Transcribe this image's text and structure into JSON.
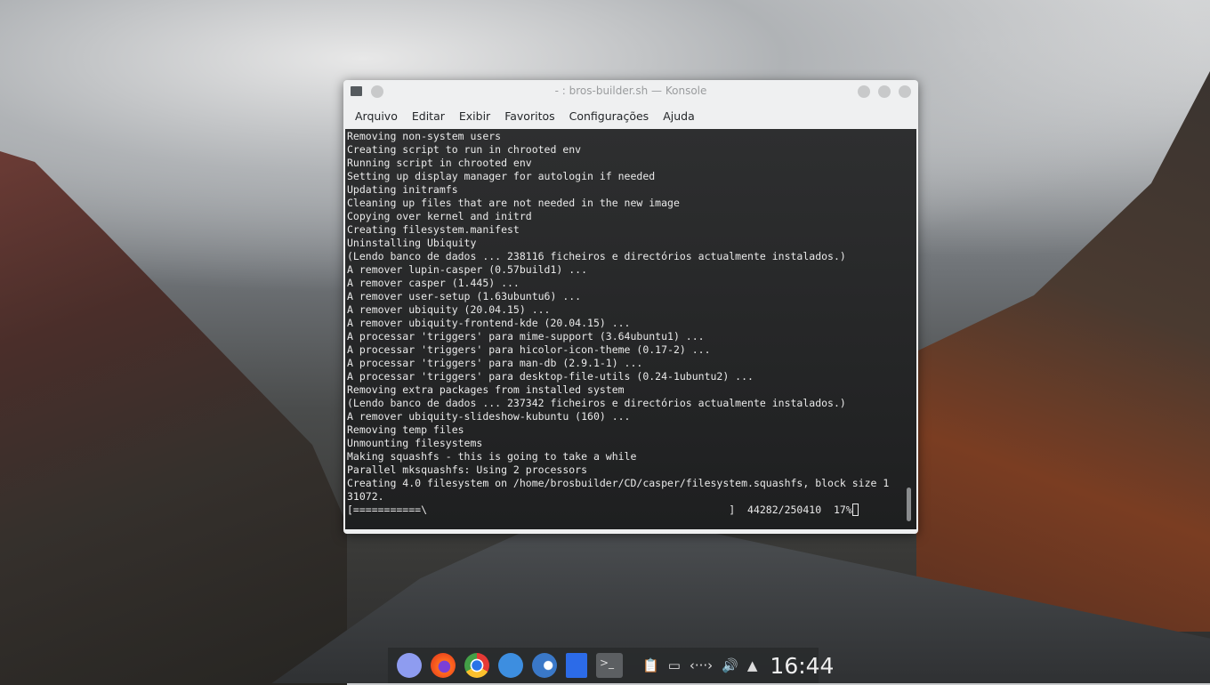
{
  "window": {
    "title": "- : bros-builder.sh — Konsole"
  },
  "menu": [
    "Arquivo",
    "Editar",
    "Exibir",
    "Favoritos",
    "Configurações",
    "Ajuda"
  ],
  "terminal": {
    "lines": [
      "Removing non-system users",
      "Creating script to run in chrooted env",
      "Running script in chrooted env",
      "Setting up display manager for autologin if needed",
      "Updating initramfs",
      "Cleaning up files that are not needed in the new image",
      "Copying over kernel and initrd",
      "Creating filesystem.manifest",
      "Uninstalling Ubiquity",
      "(Lendo banco de dados ... 238116 ficheiros e directórios actualmente instalados.)",
      "A remover lupin-casper (0.57build1) ...",
      "A remover casper (1.445) ...",
      "A remover user-setup (1.63ubuntu6) ...",
      "A remover ubiquity (20.04.15) ...",
      "A remover ubiquity-frontend-kde (20.04.15) ...",
      "A processar 'triggers' para mime-support (3.64ubuntu1) ...",
      "A processar 'triggers' para hicolor-icon-theme (0.17-2) ...",
      "A processar 'triggers' para man-db (2.9.1-1) ...",
      "A processar 'triggers' para desktop-file-utils (0.24-1ubuntu2) ...",
      "Removing extra packages from installed system",
      "(Lendo banco de dados ... 237342 ficheiros e directórios actualmente instalados.)",
      "A remover ubiquity-slideshow-kubuntu (160) ...",
      "Removing temp files",
      "Unmounting filesystems",
      "Making squashfs - this is going to take a while",
      "Parallel mksquashfs: Using 2 processors",
      "Creating 4.0 filesystem on /home/brosbuilder/CD/casper/filesystem.squashfs, block size 1",
      "31072."
    ],
    "progress_line": "[===========\\                                                 ]  44282/250410  17%"
  },
  "panel": {
    "clock": "16:44",
    "apps": [
      "app-launcher",
      "firefox",
      "chrome",
      "files",
      "system-settings",
      "discover",
      "konsole"
    ]
  }
}
